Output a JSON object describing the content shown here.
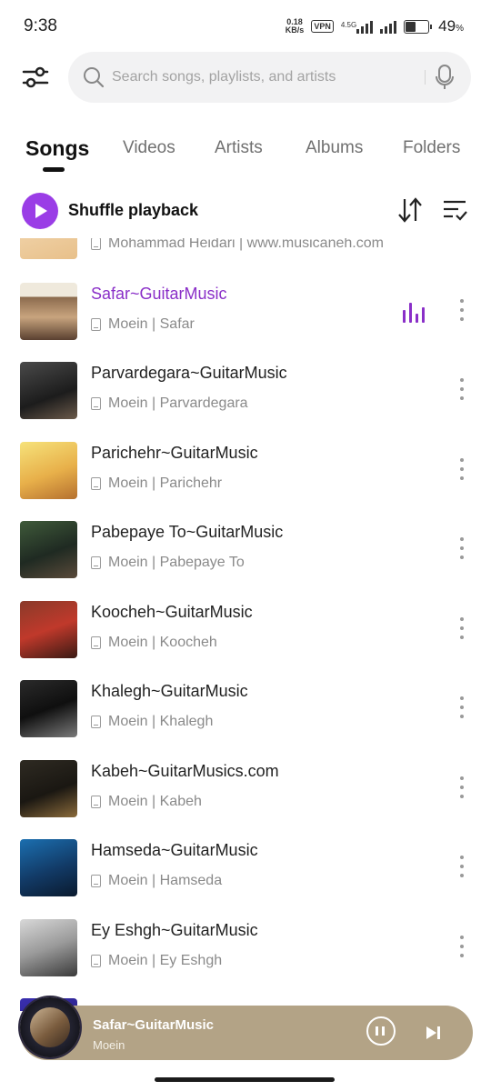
{
  "status_bar": {
    "time": "9:38",
    "speed_value": "0.18",
    "speed_unit": "KB/s",
    "vpn": "VPN",
    "network": "4.5G",
    "battery_percent": "49",
    "battery_symbol": "%",
    "battery_level": 0.49
  },
  "search": {
    "placeholder": "Search songs, playlists, and artists"
  },
  "tabs": [
    "Songs",
    "Videos",
    "Artists",
    "Albums",
    "Folders"
  ],
  "active_tab": "Songs",
  "shuffle": {
    "label": "Shuffle playback"
  },
  "songs": [
    {
      "title": "",
      "subtitle": "Mohammad Heidari | www.musicaneh.com",
      "playing": false
    },
    {
      "title": "Safar~GuitarMusic",
      "subtitle": "Moein | Safar",
      "playing": true
    },
    {
      "title": "Parvardegara~GuitarMusic",
      "subtitle": "Moein | Parvardegara",
      "playing": false
    },
    {
      "title": "Parichehr~GuitarMusic",
      "subtitle": "Moein | Parichehr",
      "playing": false
    },
    {
      "title": "Pabepaye To~GuitarMusic",
      "subtitle": "Moein | Pabepaye To",
      "playing": false
    },
    {
      "title": "Koocheh~GuitarMusic",
      "subtitle": "Moein | Koocheh",
      "playing": false
    },
    {
      "title": "Khalegh~GuitarMusic",
      "subtitle": "Moein | Khalegh",
      "playing": false
    },
    {
      "title": "Kabeh~GuitarMusics.com",
      "subtitle": "Moein | Kabeh",
      "playing": false
    },
    {
      "title": "Hamseda~GuitarMusic",
      "subtitle": "Moein | Hamseda",
      "playing": false
    },
    {
      "title": "Ey Eshgh~GuitarMusic",
      "subtitle": "Moein | Ey Eshgh",
      "playing": false
    }
  ],
  "now_playing": {
    "title": "Safar~GuitarMusic",
    "artist": "Moein"
  },
  "colors": {
    "accent": "#9a3de6",
    "playing_text": "#8a2fc8",
    "player_bar": "#b3a386"
  }
}
